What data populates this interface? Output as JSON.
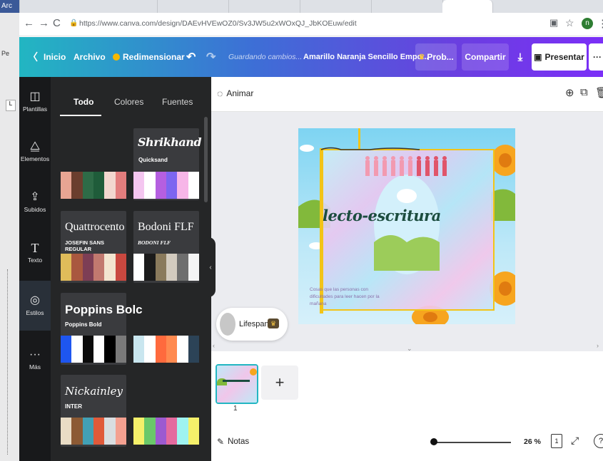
{
  "browser": {
    "tab_fragment": "Arc",
    "url": "https://www.canva.com/design/DAEvHVEwOZ0/Sv3JW5u2xWOxQJ_JbKOEuw/edit",
    "profile_initial": "n"
  },
  "left_strip": {
    "label_pe": "Pe",
    "label_l": "L"
  },
  "header": {
    "inicio": "Inicio",
    "archivo": "Archivo",
    "redimensionar": "Redimensionar",
    "saving": "Guardando cambios...",
    "doc_title": "Amarillo Naranja Sencillo Empo...",
    "prob": "Prob...",
    "compartir": "Compartir",
    "presentar": "Presentar",
    "more": "···"
  },
  "rail": {
    "items": [
      {
        "label": "Plantillas",
        "icon": "templates-icon"
      },
      {
        "label": "Elementos",
        "icon": "elements-icon"
      },
      {
        "label": "Subidos",
        "icon": "upload-icon"
      },
      {
        "label": "Texto",
        "icon": "text-icon"
      },
      {
        "label": "Estilos",
        "icon": "styles-icon"
      },
      {
        "label": "Más",
        "icon": "more-icon"
      }
    ]
  },
  "panel": {
    "tabs": [
      "Todo",
      "Colores",
      "Fuentes"
    ],
    "font_cards": [
      {
        "main": "Shrikhand",
        "sub": "Quicksand"
      },
      {
        "main": "Quattrocento",
        "sub": "JOSEFIN SANS REGULAR"
      },
      {
        "main": "Bodoni FLF",
        "sub": "BODONI FLF"
      },
      {
        "main": "Poppins Bolc",
        "sub": "Poppins Bold"
      },
      {
        "main": "Nickainley",
        "sub": "INTER"
      }
    ],
    "palettes": [
      [
        "#e8a593",
        "#6b3e2e",
        "#2e6b47",
        "#1f5c3a",
        "#f2d7cf",
        "#e27d7d"
      ],
      [
        "#f4c6f0",
        "#ffffff",
        "#b55fe0",
        "#7d65f0",
        "#f7b6e8",
        "#ffffff"
      ],
      [
        "#e0bc5a",
        "#a9583f",
        "#7d3e55",
        "#c2796f",
        "#f3e5d0",
        "#c9483f"
      ],
      [
        "#ffffff",
        "#1b1b1b",
        "#8a7a5c",
        "#d3cbbf",
        "#6e6e6e",
        "#f4f4f4"
      ],
      [
        "#1e56f0",
        "#ffffff",
        "#0b0b0b",
        "#ffffff",
        "#000000",
        "#7a7a7a"
      ],
      [
        "#c9e6ef",
        "#ffffff",
        "#ff6a3d",
        "#ff8a50",
        "#ffffff",
        "#2c4357"
      ],
      [
        "#e9dcc5",
        "#8c5a34",
        "#42a0b5",
        "#e05a3a",
        "#d9dde0",
        "#f4a090"
      ],
      [
        "#f5f06a",
        "#6ac86a",
        "#9c5ad0",
        "#e46a9e",
        "#9ff3f0",
        "#f5f06a"
      ]
    ]
  },
  "context_bar": {
    "animar": "Animar"
  },
  "design": {
    "title": "lecto-escritura",
    "body": "Cosas que las personas con dificultades para leer hacen por la mañana"
  },
  "lifespan": {
    "label": "Lifespan"
  },
  "pages": {
    "number": "1",
    "add": "+"
  },
  "footer": {
    "notas": "Notas",
    "zoom": "26 %",
    "zoom_level": 0.26,
    "page_count": "1",
    "help": "?"
  },
  "colors": {
    "header_start": "#22b6c2",
    "header_end": "#7b2ff7",
    "rail_bg": "#18191b",
    "panel_bg": "#252627"
  }
}
